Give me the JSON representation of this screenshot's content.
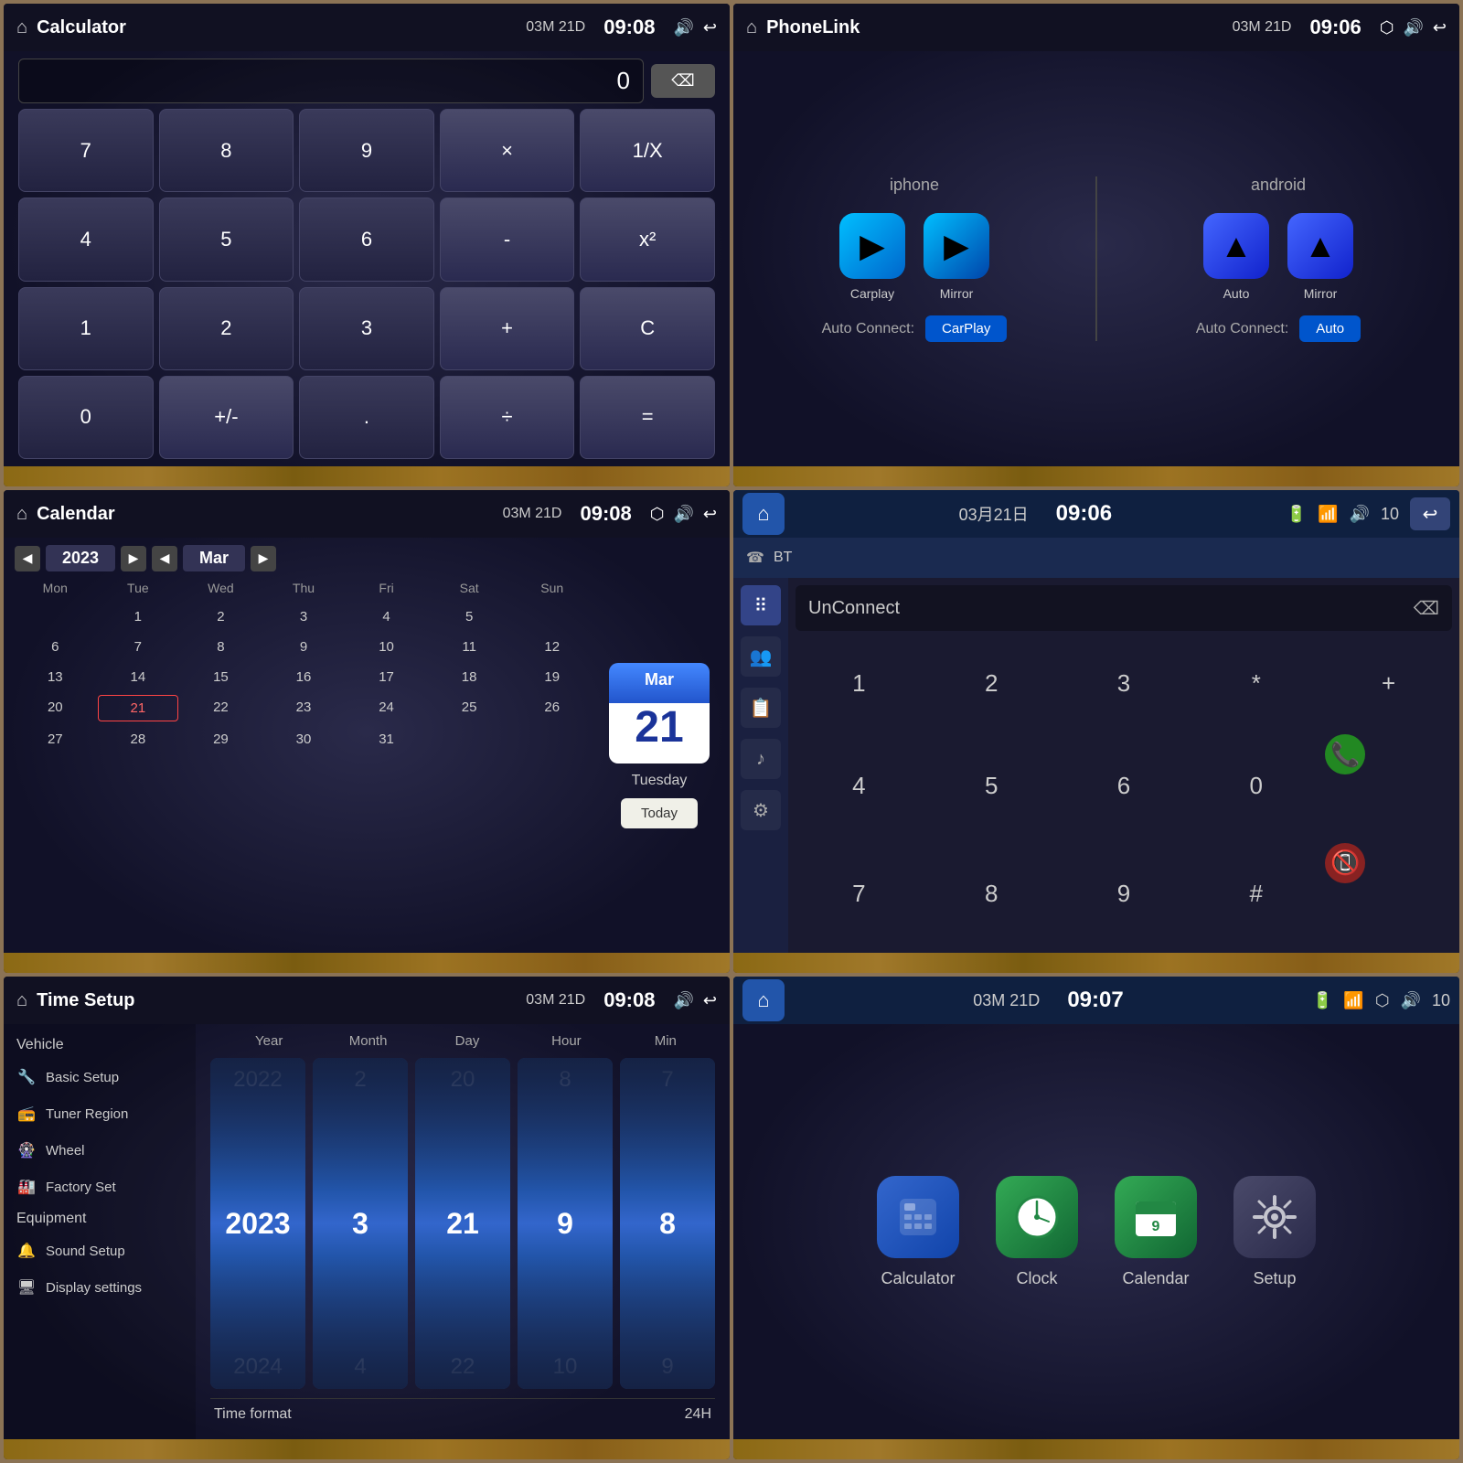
{
  "calculator": {
    "title": "Calculator",
    "date": "03M 21D",
    "time": "09:08",
    "display_value": "0",
    "buttons": [
      {
        "label": "7",
        "type": "num"
      },
      {
        "label": "8",
        "type": "num"
      },
      {
        "label": "9",
        "type": "num"
      },
      {
        "label": "×",
        "type": "op"
      },
      {
        "label": "1/X",
        "type": "op"
      },
      {
        "label": "4",
        "type": "num"
      },
      {
        "label": "5",
        "type": "num"
      },
      {
        "label": "6",
        "type": "num"
      },
      {
        "label": "-",
        "type": "op"
      },
      {
        "label": "x²",
        "type": "op"
      },
      {
        "label": "1",
        "type": "num"
      },
      {
        "label": "2",
        "type": "num"
      },
      {
        "label": "3",
        "type": "num"
      },
      {
        "label": "+",
        "type": "op"
      },
      {
        "label": "C",
        "type": "op"
      },
      {
        "label": "0",
        "type": "num"
      },
      {
        "label": "+/-",
        "type": "op"
      },
      {
        "label": ".",
        "type": "num"
      },
      {
        "label": "÷",
        "type": "op"
      },
      {
        "label": "=",
        "type": "op"
      }
    ],
    "backspace_label": "⌫"
  },
  "phonelink": {
    "title": "PhoneLink",
    "date": "03M 21D",
    "time": "09:06",
    "iphone_label": "iphone",
    "android_label": "android",
    "carplay_label": "Carplay",
    "imirror_label": "Mirror",
    "auto_label": "Auto",
    "amirror_label": "Mirror",
    "auto_connect_label": "Auto Connect:",
    "carplay_btn": "CarPlay",
    "auto_btn": "Auto"
  },
  "calendar": {
    "title": "Calendar",
    "date": "03M 21D",
    "time": "09:08",
    "year": "2023",
    "month": "Mar",
    "month_label": "Mar",
    "day_label": "21",
    "weekday_label": "Tuesday",
    "today_btn": "Today",
    "headers": [
      "Mon",
      "Tue",
      "Wed",
      "Thu",
      "Fri",
      "Sat",
      "Sun"
    ],
    "rows": [
      [
        "",
        "1",
        "2",
        "3",
        "4",
        "5"
      ],
      [
        "6",
        "7",
        "8",
        "9",
        "10",
        "11",
        "12"
      ],
      [
        "13",
        "14",
        "15",
        "16",
        "17",
        "18",
        "19"
      ],
      [
        "20",
        "21",
        "22",
        "23",
        "24",
        "25",
        "26"
      ],
      [
        "27",
        "28",
        "29",
        "30",
        "31"
      ]
    ]
  },
  "bt": {
    "date": "03月21日",
    "time": "09:06",
    "volume": "10",
    "bt_label": "BT",
    "display_text": "UnConnect",
    "dial_buttons": [
      "1",
      "2",
      "3",
      "*",
      "+",
      "4",
      "5",
      "6",
      "0",
      "📞",
      "7",
      "8",
      "9",
      "#",
      "📵"
    ]
  },
  "timesetup": {
    "title": "Time Setup",
    "date": "03M 21D",
    "time": "09:08",
    "vehicle_label": "Vehicle",
    "basic_setup": "Basic Setup",
    "tuner_region": "Tuner Region",
    "wheel": "Wheel",
    "factory_set": "Factory Set",
    "equipment_label": "Equipment",
    "sound_setup": "Sound Setup",
    "display_settings": "Display settings",
    "year_label": "Year",
    "month_label": "Month",
    "day_label": "Day",
    "hour_label": "Hour",
    "min_label": "Min",
    "year_value": "2023",
    "month_value": "3",
    "day_value": "21",
    "hour_value": "9",
    "min_value": "8",
    "time_format_label": "Time format",
    "time_format_value": "24H"
  },
  "launcher": {
    "date": "03M 21D",
    "time": "09:07",
    "volume": "10",
    "apps": [
      {
        "label": "Calculator",
        "icon": "⚙️",
        "class": "app-calculator"
      },
      {
        "label": "Clock",
        "icon": "🕐",
        "class": "app-clock"
      },
      {
        "label": "Calendar",
        "icon": "📅",
        "class": "app-calendar"
      },
      {
        "label": "Setup",
        "icon": "⚙",
        "class": "app-setup"
      }
    ]
  }
}
